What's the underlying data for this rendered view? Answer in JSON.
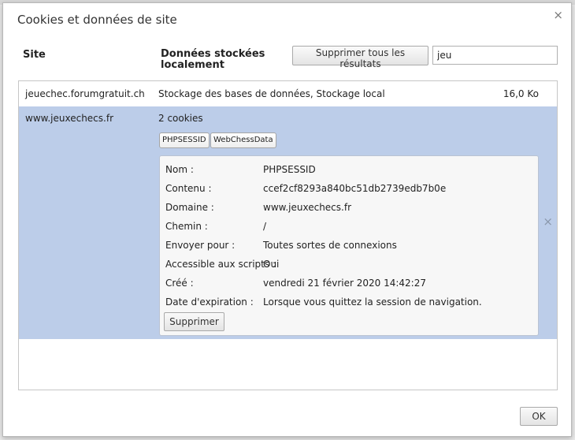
{
  "dialog": {
    "title": "Cookies et données de site",
    "close_glyph": "×"
  },
  "header": {
    "col_site": "Site",
    "col_data": "Données stockées localement",
    "remove_all_label": "Supprimer tous les résultats",
    "search_value": "jeu"
  },
  "rows": [
    {
      "site": "jeuechec.forumgratuit.ch",
      "data": "Stockage des bases de données, Stockage local",
      "size": "16,0 Ko"
    },
    {
      "site": "www.jeuxechecs.fr",
      "data": "2 cookies",
      "chips": [
        "PHPSESSID",
        "WebChessData"
      ],
      "remove_glyph": "×"
    }
  ],
  "details": {
    "labels": {
      "name": "Nom :",
      "content": "Contenu :",
      "domain": "Domaine :",
      "path": "Chemin :",
      "send_for": "Envoyer pour :",
      "scripts": "Accessible aux scripts :",
      "created": "Créé :",
      "expires": "Date d'expiration :"
    },
    "values": {
      "name": "PHPSESSID",
      "content": "ccef2cf8293a840bc51db2739edb7b0e",
      "domain": "www.jeuxechecs.fr",
      "path": "/",
      "send_for": "Toutes sortes de connexions",
      "scripts": "Oui",
      "created": "vendredi 21 février 2020 14:42:27",
      "expires": "Lorsque vous quittez la session de navigation."
    },
    "delete_label": "Supprimer"
  },
  "footer": {
    "ok_label": "OK"
  }
}
